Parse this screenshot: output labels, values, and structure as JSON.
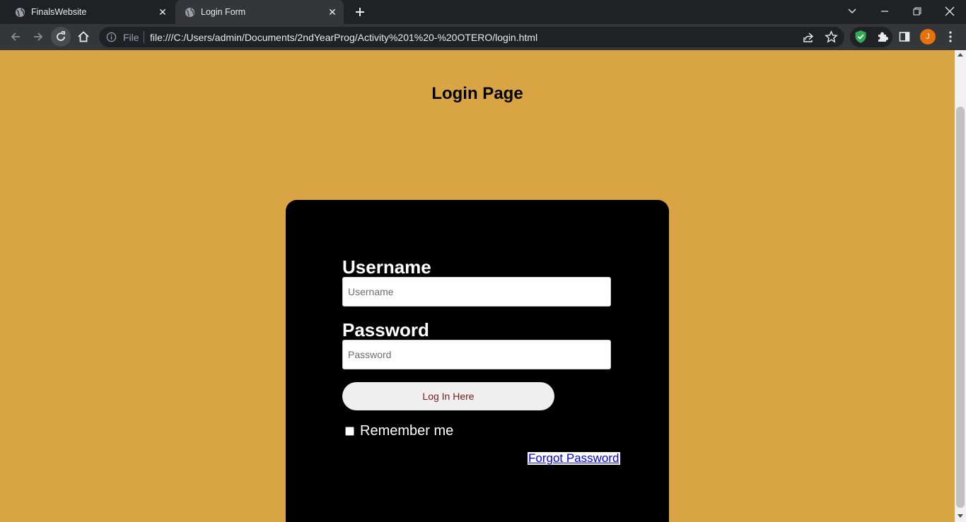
{
  "browser": {
    "tabs": [
      {
        "title": "FinalsWebsite",
        "active": false
      },
      {
        "title": "Login Form",
        "active": true
      }
    ],
    "address_prefix": "File",
    "url": "file:///C:/Users/admin/Documents/2ndYearProg/Activity%201%20-%20OTERO/login.html",
    "profile_initial": "J",
    "colors": {
      "tab_strip": "#202124",
      "toolbar": "#35363a",
      "profile": "#e8710a"
    }
  },
  "page": {
    "heading": "Login Page",
    "username_label": "Username",
    "username_placeholder": "Username",
    "password_label": "Password",
    "password_placeholder": "Password",
    "login_button": "Log In Here",
    "remember_label": "Remember me",
    "forgot_link": "Forgot Password",
    "colors": {
      "background": "#d8a444",
      "card": "#000000",
      "button_text": "#7a1b1b",
      "link": "#0000ee"
    }
  }
}
